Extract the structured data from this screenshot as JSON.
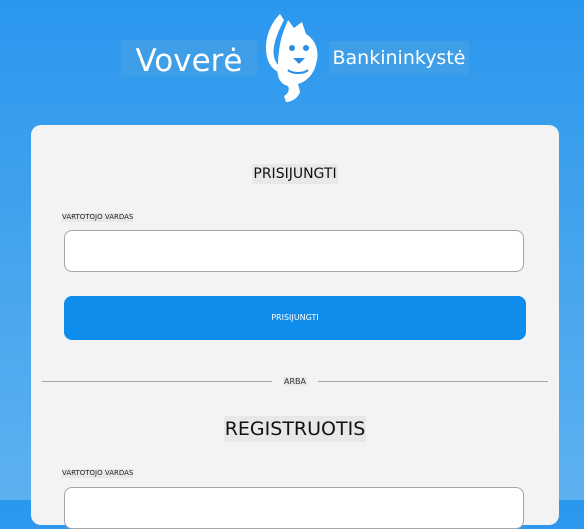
{
  "header": {
    "brand_left": "Voverė",
    "brand_right": "Bankininkystė",
    "logo_icon": "squirrel-logo-icon"
  },
  "login": {
    "title": "PRISIJUNGTI",
    "username_label": "VARTOTOJO VARDAS",
    "username_value": "",
    "submit_label": "PRISIJUNGTI"
  },
  "divider": {
    "text": "ARBA"
  },
  "register": {
    "title": "REGISTRUOTIS",
    "username_label": "VARTOTOJO VARDAS",
    "username_value": ""
  },
  "colors": {
    "background_top": "#2a97ee",
    "background_bottom": "#5eb1ef",
    "brand_box": "#3e9ee8",
    "card": "#f3f3f3",
    "primary_button": "#0e8ded"
  }
}
